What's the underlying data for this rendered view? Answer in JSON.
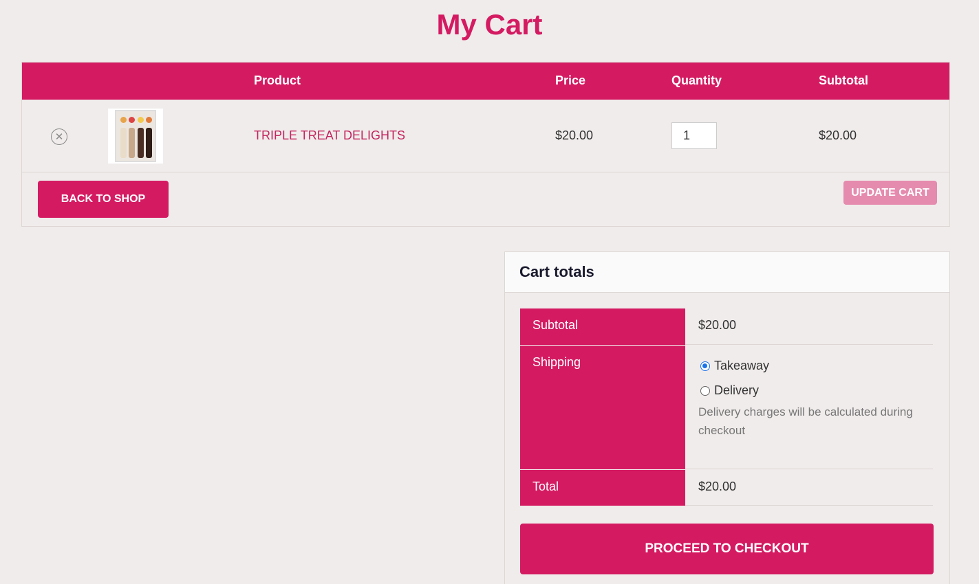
{
  "page": {
    "title": "My Cart"
  },
  "cart": {
    "headers": {
      "product": "Product",
      "price": "Price",
      "quantity": "Quantity",
      "subtotal": "Subtotal"
    },
    "items": [
      {
        "name": "TRIPLE TREAT DELIGHTS",
        "price": "$20.00",
        "quantity": "1",
        "subtotal": "$20.00",
        "remove_icon": "remove-circle-icon"
      }
    ],
    "back_label": "BACK TO SHOP",
    "update_label": "UPDATE CART"
  },
  "totals": {
    "heading": "Cart totals",
    "subtotal_label": "Subtotal",
    "subtotal_value": "$20.00",
    "shipping_label": "Shipping",
    "shipping_options": [
      {
        "label": "Takeaway",
        "selected": true
      },
      {
        "label": "Delivery",
        "selected": false
      }
    ],
    "shipping_note": "Delivery charges will be calculated during checkout",
    "total_label": "Total",
    "total_value": "$20.00",
    "checkout_label": "PROCEED TO CHECKOUT"
  },
  "colors": {
    "accent": "#d41b62",
    "accent_light": "#e58bae",
    "background": "#f0eceb",
    "radio": "#1a73e8"
  }
}
